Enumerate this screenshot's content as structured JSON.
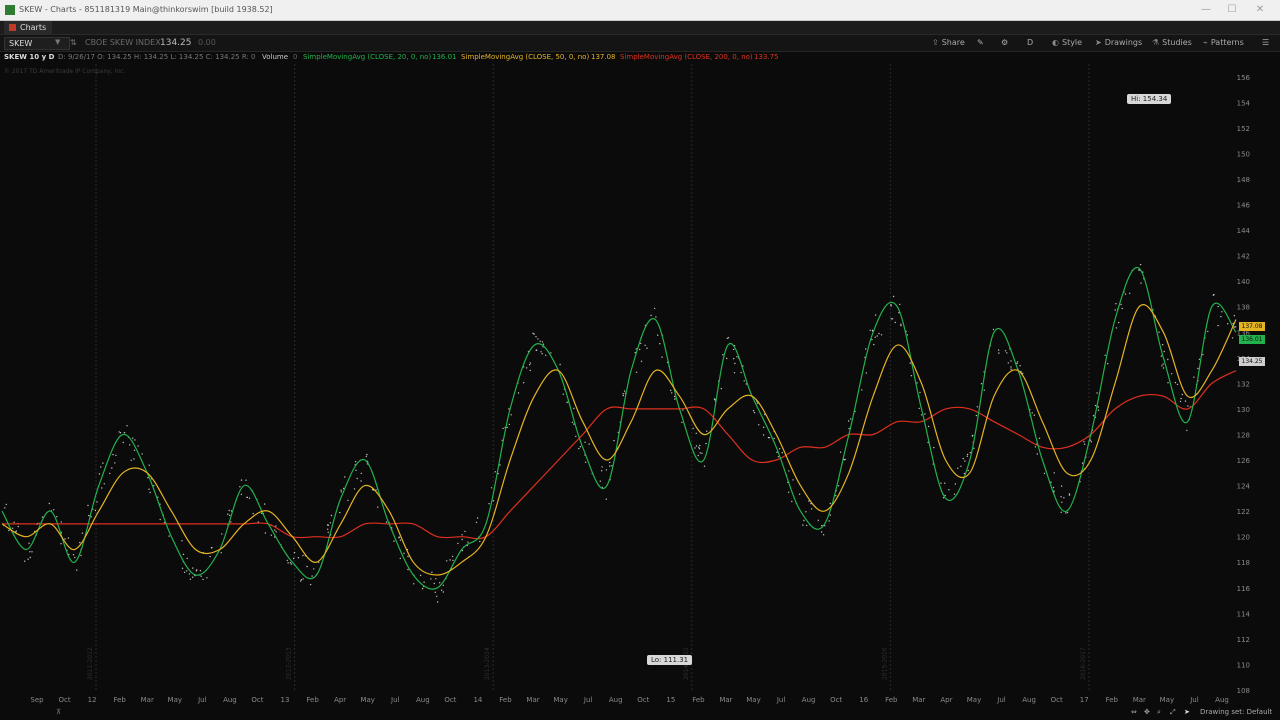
{
  "window": {
    "title": "SKEW - Charts - 851181319 Main@thinkorswim [build 1938.52]",
    "minimize": "—",
    "maximize": "☐",
    "close": "✕"
  },
  "tabs": [
    {
      "label": "Charts"
    }
  ],
  "toolbar": {
    "symbol": "SKEW",
    "description": "CBOE SKEW INDEX",
    "last_price": "134.25",
    "change": "0.00",
    "share_label": "Share",
    "style_label": "Style",
    "drawings_label": "Drawings",
    "studies_label": "Studies",
    "patterns_label": "Patterns",
    "timeframe_label": "D"
  },
  "study_bar": {
    "timeframe": "SKEW 10 y D",
    "ohlc": "D: 9/26/17   O: 134.25   H: 134.25   L: 134.25   C: 134.25   R: 0",
    "volume_label": "Volume",
    "volume_value": "0",
    "sma20_label": "SimpleMovingAvg (CLOSE, 20, 0, no)",
    "sma20_value": "136.01",
    "sma50_label": "SimpleMovingAvg (CLOSE, 50, 0, no)",
    "sma50_value": "137.08",
    "sma200_label": "SimpleMovingAvg (CLOSE, 200, 0, no)",
    "sma200_value": "133.75",
    "copyright": "© 2017 TD Ameritrade IP Company, Inc."
  },
  "colors": {
    "background": "#0b0b0b",
    "price_dots": "#ffffff",
    "sma20": "#22b14c",
    "sma50": "#e6b422",
    "sma200": "#e0301e",
    "grid": "#2a2a2a"
  },
  "annotations": {
    "high": "Hi: 154.34",
    "low": "Lo: 111.31"
  },
  "price_tags": {
    "sma50": "137.08",
    "sma20": "136.01",
    "last": "134.25"
  },
  "bottom": {
    "drawing_set": "Drawing set: Default"
  },
  "chart_data": {
    "type": "line",
    "title": "",
    "xlabel": "",
    "ylabel": "",
    "ylim": [
      108,
      157
    ],
    "y_ticks": [
      "108",
      "110",
      "112",
      "114",
      "116",
      "118",
      "120",
      "122",
      "124",
      "126",
      "128",
      "130",
      "132",
      "134",
      "136",
      "138",
      "140",
      "142",
      "144",
      "146",
      "148",
      "150",
      "152",
      "154",
      "156"
    ],
    "x_ticks": [
      "Sep",
      "Oct",
      "12",
      "Feb",
      "Mar",
      "May",
      "Jul",
      "Aug",
      "Oct",
      "13",
      "Feb",
      "Apr",
      "May",
      "Jul",
      "Aug",
      "Oct",
      "14",
      "Feb",
      "Mar",
      "May",
      "Jul",
      "Aug",
      "Oct",
      "15",
      "Feb",
      "Mar",
      "May",
      "Jul",
      "Aug",
      "Oct",
      "16",
      "Feb",
      "Mar",
      "Apr",
      "May",
      "Jul",
      "Aug",
      "Oct",
      "17",
      "Feb",
      "Mar",
      "May",
      "Jul",
      "Aug"
    ],
    "year_labels": [
      "2011-2012",
      "2012-2013",
      "2013-2014",
      "2014-2015",
      "2015-2016",
      "2016-2017"
    ],
    "series": [
      {
        "name": "SimpleMovingAvg (CLOSE, 20, 0, no)",
        "color": "#22b14c",
        "values": [
          122,
          119,
          122,
          118,
          124,
          128,
          125,
          120,
          117,
          119,
          124,
          121,
          118,
          117,
          123,
          126,
          121,
          117,
          116,
          119,
          121,
          130,
          135,
          133,
          127,
          124,
          133,
          137,
          130,
          126,
          135,
          131,
          127,
          122,
          121,
          128,
          136,
          138,
          130,
          123,
          126,
          136,
          133,
          126,
          122,
          128,
          137,
          141,
          134,
          129,
          138,
          136
        ]
      },
      {
        "name": "SimpleMovingAvg (CLOSE, 50, 0, no)",
        "color": "#e6b422",
        "values": [
          121,
          120,
          121,
          119,
          122,
          125,
          125,
          122,
          119,
          119,
          121,
          122,
          120,
          118,
          121,
          124,
          122,
          118,
          117,
          118,
          120,
          126,
          131,
          133,
          129,
          126,
          129,
          133,
          131,
          128,
          130,
          131,
          128,
          124,
          122,
          125,
          131,
          135,
          132,
          126,
          125,
          131,
          133,
          129,
          125,
          126,
          132,
          138,
          136,
          131,
          133,
          137
        ]
      },
      {
        "name": "SimpleMovingAvg (CLOSE, 200, 0, no)",
        "color": "#e0301e",
        "values": [
          121,
          121,
          121,
          121,
          121,
          121,
          121,
          121,
          121,
          121,
          121,
          121,
          120,
          120,
          120,
          121,
          121,
          121,
          120,
          120,
          120,
          122,
          124,
          126,
          128,
          130,
          130,
          130,
          130,
          130,
          128,
          126,
          126,
          127,
          127,
          128,
          128,
          129,
          129,
          130,
          130,
          129,
          128,
          127,
          127,
          128,
          130,
          131,
          131,
          130,
          132,
          133
        ]
      }
    ]
  }
}
